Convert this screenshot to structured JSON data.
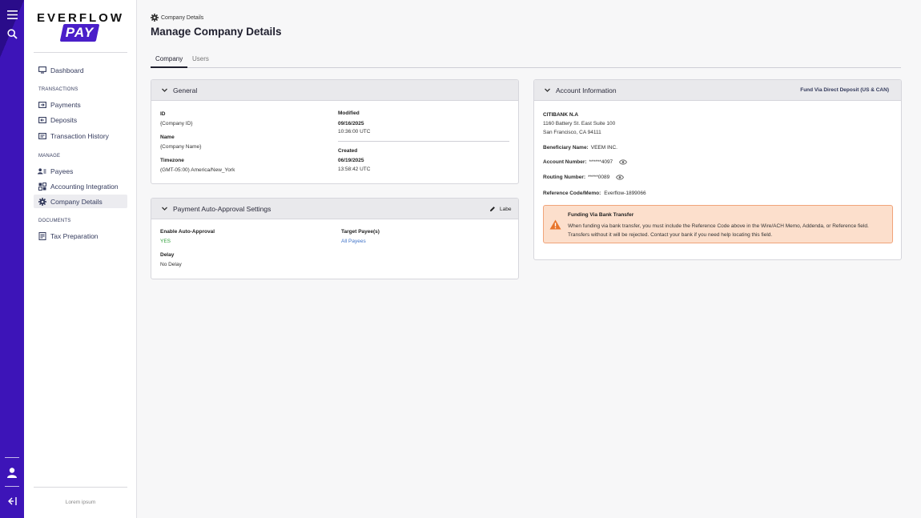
{
  "brand": {
    "wordmark": "EVERFLOW",
    "badge": "PAY"
  },
  "sidebar": {
    "items": [
      {
        "label": "Dashboard",
        "icon": "monitor-icon"
      },
      {
        "label": "Payments",
        "icon": "payments-icon"
      },
      {
        "label": "Deposits",
        "icon": "deposits-icon"
      },
      {
        "label": "Transaction History",
        "icon": "history-icon"
      },
      {
        "label": "Payees",
        "icon": "payees-icon"
      },
      {
        "label": "Accounting Integration",
        "icon": "integration-icon"
      },
      {
        "label": "Company Details",
        "icon": "gear-icon"
      },
      {
        "label": "Tax Preparation",
        "icon": "tax-icon"
      }
    ],
    "sections": {
      "transactions": "TRANSACTIONS",
      "manage": "MANAGE",
      "documents": "DOCUMENTS"
    },
    "footer": "Lorem ipsum"
  },
  "breadcrumb": "Company Details",
  "page_title": "Manage Company Details",
  "tabs": [
    "Company",
    "Users"
  ],
  "general": {
    "title": "General",
    "id_label": "ID",
    "id_value": "{Company ID}",
    "name_label": "Name",
    "name_value": "{Company Name}",
    "tz_label": "Timezone",
    "tz_value": "(GMT-05:00) America/New_York",
    "modified_label": "Modified",
    "modified_date": "09/16/2025",
    "modified_time": "10:36:00 UTC",
    "created_label": "Created",
    "created_date": "06/19/2025",
    "created_time": "13:58:42 UTC"
  },
  "auto_approval": {
    "title": "Payment Auto-Approval Settings",
    "edit_label": "Labe",
    "enable_label": "Enable Auto-Approval",
    "enable_value": "YES",
    "target_label": "Target Payee(s)",
    "target_value": "All Payees",
    "delay_label": "Delay",
    "delay_value": "No Delay"
  },
  "account": {
    "title": "Account Information",
    "method": "Fund Via Direct Deposit (US & CAN)",
    "bank": "CITIBANK N.A",
    "addr1": "1160 Battery St. East Suite 100",
    "addr2": "San Francisco, CA 94111",
    "beneficiary_label": "Beneficiary Name:",
    "beneficiary_value": "VEEM INC.",
    "account_label": "Account Number:",
    "account_value": "******4097",
    "routing_label": "Routing Number:",
    "routing_value": "*****0089",
    "reference_label": "Reference Code/Memo:",
    "reference_value": "Everflow-1899066",
    "warning_title": "Funding Via Bank Transfer",
    "warning_body": "When funding via bank transfer, you must include the Reference Code above in the Wire/ACH Memo, Addenda, or Reference field. Transfers without it will be rejected. Contact your bank if you need help locating this field."
  },
  "colors": {
    "rail": "#3d14b8",
    "brand": "#4a1fc9",
    "accent_green": "#2f9e3a",
    "link_blue": "#3f73c8",
    "warning_bg": "#fcdfcc"
  }
}
